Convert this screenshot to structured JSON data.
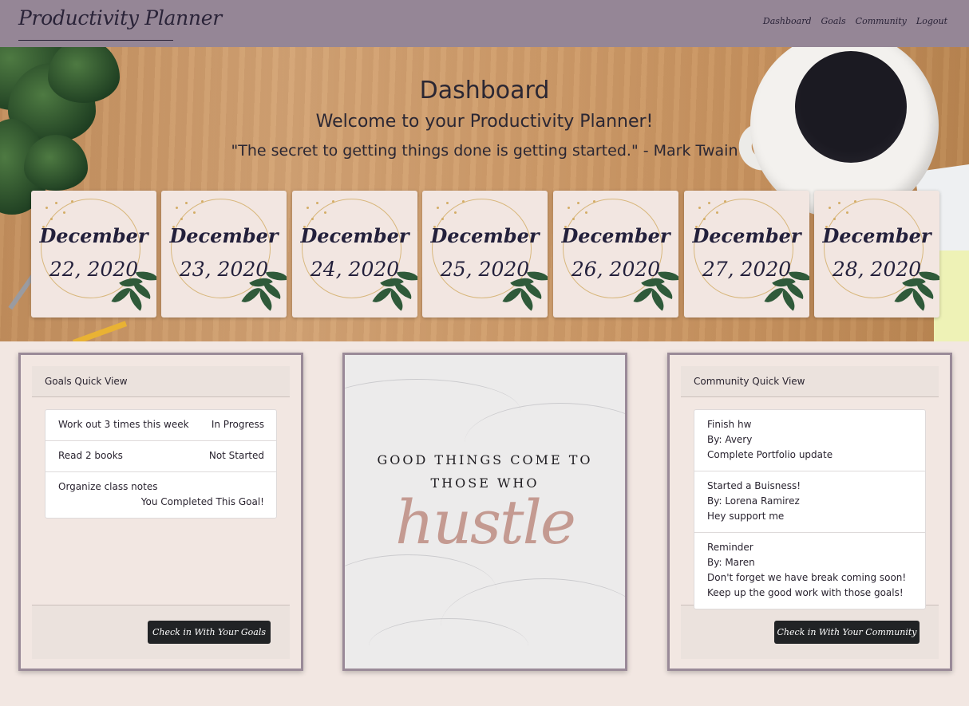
{
  "navbar": {
    "brand": "Productivity Planner",
    "links": [
      "Dashboard",
      "Goals",
      "Community",
      "Logout"
    ]
  },
  "hero": {
    "title": "Dashboard",
    "welcome": "Welcome to your Productivity Planner!",
    "quote": "\"The secret to getting things done is getting started.\" - Mark Twain"
  },
  "dates": [
    {
      "month": "December",
      "day": "22, 2020"
    },
    {
      "month": "December",
      "day": "23, 2020"
    },
    {
      "month": "December",
      "day": "24, 2020"
    },
    {
      "month": "December",
      "day": "25, 2020"
    },
    {
      "month": "December",
      "day": "26, 2020"
    },
    {
      "month": "December",
      "day": "27, 2020"
    },
    {
      "month": "December",
      "day": "28, 2020"
    }
  ],
  "goals": {
    "header": "Goals Quick View",
    "items": [
      {
        "text": "Work out 3 times this week",
        "status": "In Progress"
      },
      {
        "text": "Read 2 books",
        "status": "Not Started"
      },
      {
        "text": "Organize class notes",
        "status": "You Completed This Goal!"
      }
    ],
    "button": "Check in With Your Goals"
  },
  "quote_image": {
    "line1": "GOOD THINGS COME TO",
    "line2": "THOSE WHO",
    "script": "hustle"
  },
  "community": {
    "header": "Community Quick View",
    "posts": [
      {
        "title": "Finish hw",
        "author": "By: Avery",
        "body": [
          "Complete Portfolio update"
        ]
      },
      {
        "title": "Started a Buisness!",
        "author": "By: Lorena Ramirez",
        "body": [
          "Hey support me"
        ]
      },
      {
        "title": "Reminder",
        "author": "By: Maren",
        "body": [
          "Don't forget we have break coming soon!",
          "Keep up the good work with those goals!"
        ]
      }
    ],
    "button": "Check in With Your Community"
  },
  "colors": {
    "navbar": "#958696",
    "page_bg": "#f2e7e2",
    "panel_border": "#9a8a98",
    "button": "#212325",
    "hustle": "#c49a91"
  }
}
